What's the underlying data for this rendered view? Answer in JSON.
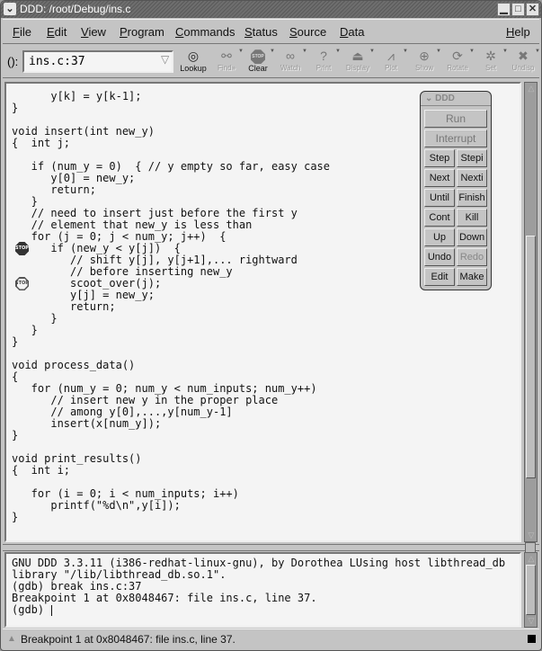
{
  "window": {
    "title": "DDD: /root/Debug/ins.c",
    "menu_icon": "chevron-down-icon",
    "controls": [
      "minimize",
      "maximize",
      "close"
    ]
  },
  "menubar": {
    "items": [
      {
        "label": "File",
        "mnemonic": "F"
      },
      {
        "label": "Edit",
        "mnemonic": "E"
      },
      {
        "label": "View",
        "mnemonic": "V"
      },
      {
        "label": "Program",
        "mnemonic": "P"
      },
      {
        "label": "Commands",
        "mnemonic": "C"
      },
      {
        "label": "Status",
        "mnemonic": "S"
      },
      {
        "label": "Source",
        "mnemonic": "S"
      },
      {
        "label": "Data",
        "mnemonic": "D"
      }
    ],
    "help": {
      "label": "Help",
      "mnemonic": "H"
    }
  },
  "toolbar": {
    "arg_label": "():",
    "arg_value": "ins.c:37",
    "buttons": [
      {
        "label": "Lookup",
        "icon": "lookup-target-icon",
        "enabled": true,
        "has_menu": false
      },
      {
        "label": "Find»",
        "icon": "find-binoculars-icon",
        "enabled": false,
        "has_menu": true
      },
      {
        "label": "Clear",
        "icon": "stop-sign-icon",
        "enabled": true,
        "has_menu": true
      },
      {
        "label": "Watch",
        "icon": "watch-glasses-icon",
        "enabled": false,
        "has_menu": true
      },
      {
        "label": "Print",
        "icon": "question-mark-icon",
        "enabled": false,
        "has_menu": true
      },
      {
        "label": "Display",
        "icon": "display-icon",
        "enabled": false,
        "has_menu": true
      },
      {
        "label": "Plot",
        "icon": "plot-icon",
        "enabled": false,
        "has_menu": true
      },
      {
        "label": "Show",
        "icon": "magnifier-icon",
        "enabled": false,
        "has_menu": true
      },
      {
        "label": "Rotate",
        "icon": "rotate-icon",
        "enabled": false,
        "has_menu": true
      },
      {
        "label": "Set",
        "icon": "set-icon",
        "enabled": false,
        "has_menu": true
      },
      {
        "label": "Undisp",
        "icon": "undisplay-icon",
        "enabled": false,
        "has_menu": true
      }
    ]
  },
  "source": {
    "lines": [
      "      y[k] = y[k-1];",
      "}",
      "",
      "void insert(int new_y)",
      "{  int j;",
      "",
      "   if (num_y = 0)  { // y empty so far, easy case",
      "      y[0] = new_y;",
      "      return;",
      "   }",
      "   // need to insert just before the first y",
      "   // element that new_y is less than",
      "   for (j = 0; j < num_y; j++)  {",
      "      if (new_y < y[j])  {",
      "         // shift y[j], y[j+1],... rightward",
      "         // before inserting new_y",
      "         scoot_over(j);",
      "         y[j] = new_y;",
      "         return;",
      "      }",
      "   }",
      "}",
      "",
      "void process_data()",
      "{",
      "   for (num_y = 0; num_y < num_inputs; num_y++)",
      "      // insert new y in the proper place",
      "      // among y[0],...,y[num_y-1]",
      "      insert(x[num_y]);",
      "}",
      "",
      "void print_results()",
      "{  int i;",
      "",
      "   for (i = 0; i < num_inputs; i++)",
      "      printf(\"%d\\n\",y[i]);",
      "}"
    ],
    "breakpoints": [
      {
        "line_index": 13,
        "label": "STOP",
        "state": "enabled"
      },
      {
        "line_index": 16,
        "label": "STOP",
        "state": "disabled"
      }
    ]
  },
  "command_tool": {
    "title": "DDD",
    "wide_buttons": [
      {
        "label": "Run",
        "enabled": false
      },
      {
        "label": "Interrupt",
        "enabled": false
      }
    ],
    "rows": [
      [
        {
          "label": "Step",
          "enabled": true
        },
        {
          "label": "Stepi",
          "enabled": true
        }
      ],
      [
        {
          "label": "Next",
          "enabled": true
        },
        {
          "label": "Nexti",
          "enabled": true
        }
      ],
      [
        {
          "label": "Until",
          "enabled": true
        },
        {
          "label": "Finish",
          "enabled": true
        }
      ],
      [
        {
          "label": "Cont",
          "enabled": true
        },
        {
          "label": "Kill",
          "enabled": true
        }
      ],
      [
        {
          "label": "Up",
          "enabled": true
        },
        {
          "label": "Down",
          "enabled": true
        }
      ],
      [
        {
          "label": "Undo",
          "enabled": true
        },
        {
          "label": "Redo",
          "enabled": false
        }
      ],
      [
        {
          "label": "Edit",
          "enabled": true
        },
        {
          "label": "Make",
          "enabled": true
        }
      ]
    ]
  },
  "console": {
    "lines": [
      "GNU DDD 3.3.11 (i386-redhat-linux-gnu), by Dorothea LUsing host libthread_db",
      "library \"/lib/libthread_db.so.1\".",
      "(gdb) break ins.c:37",
      "Breakpoint 1 at 0x8048467: file ins.c, line 37."
    ],
    "prompt": "(gdb) "
  },
  "statusbar": {
    "text": "Breakpoint 1 at 0x8048467: file ins.c, line 37."
  }
}
